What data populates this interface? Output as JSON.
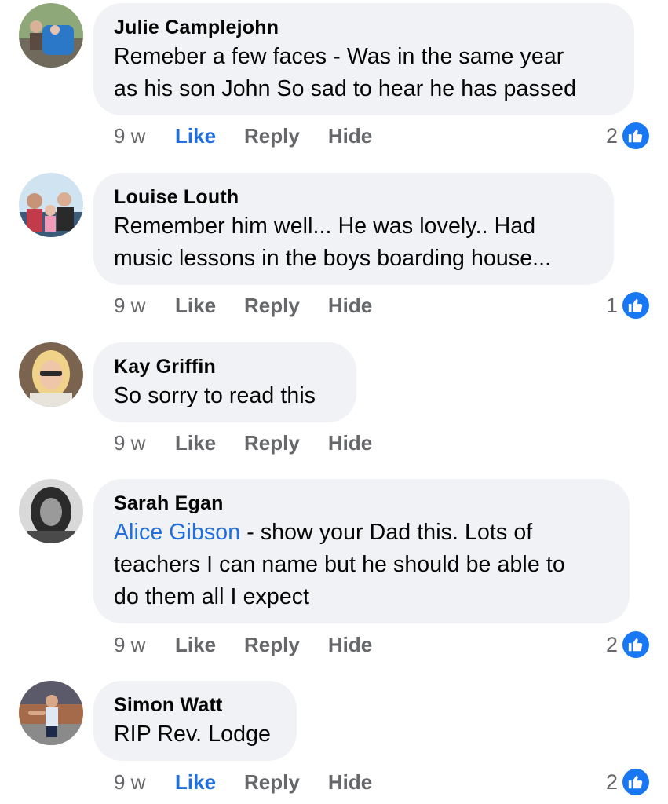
{
  "comments": [
    {
      "author": "Julie Camplejohn",
      "text_lines": [
        "Remeber a few faces - Was in the same year",
        "as his son John So sad to hear he has passed"
      ],
      "time": "9 w",
      "like_label": "Like",
      "reply_label": "Reply",
      "hide_label": "Hide",
      "liked": true,
      "reactions": "2"
    },
    {
      "author": "Louise Louth",
      "text_lines": [
        "Remember him well... He was lovely.. Had",
        "music lessons in the boys boarding house..."
      ],
      "time": "9 w",
      "like_label": "Like",
      "reply_label": "Reply",
      "hide_label": "Hide",
      "liked": false,
      "reactions": "1"
    },
    {
      "author": "Kay Griffin",
      "text_lines": [
        "So sorry to read this"
      ],
      "time": "9 w",
      "like_label": "Like",
      "reply_label": "Reply",
      "hide_label": "Hide",
      "liked": false,
      "reactions": null
    },
    {
      "author": "Sarah Egan",
      "mention": "Alice Gibson",
      "text_lines": [
        " - show your Dad this. Lots of",
        "teachers I can name but he should be able to",
        "do them all I expect"
      ],
      "time": "9 w",
      "like_label": "Like",
      "reply_label": "Reply",
      "hide_label": "Hide",
      "liked": false,
      "reactions": "2"
    },
    {
      "author": "Simon Watt",
      "text_lines": [
        "RIP Rev. Lodge"
      ],
      "time": "9 w",
      "like_label": "Like",
      "reply_label": "Reply",
      "hide_label": "Hide",
      "liked": true,
      "reactions": "2"
    }
  ],
  "colors": {
    "bubble": "#f0f2f5",
    "link_blue": "#216fdb",
    "reaction_blue": "#1877f2",
    "meta_gray": "#65676b"
  },
  "icons": {
    "reaction": "thumbs-up-icon"
  }
}
